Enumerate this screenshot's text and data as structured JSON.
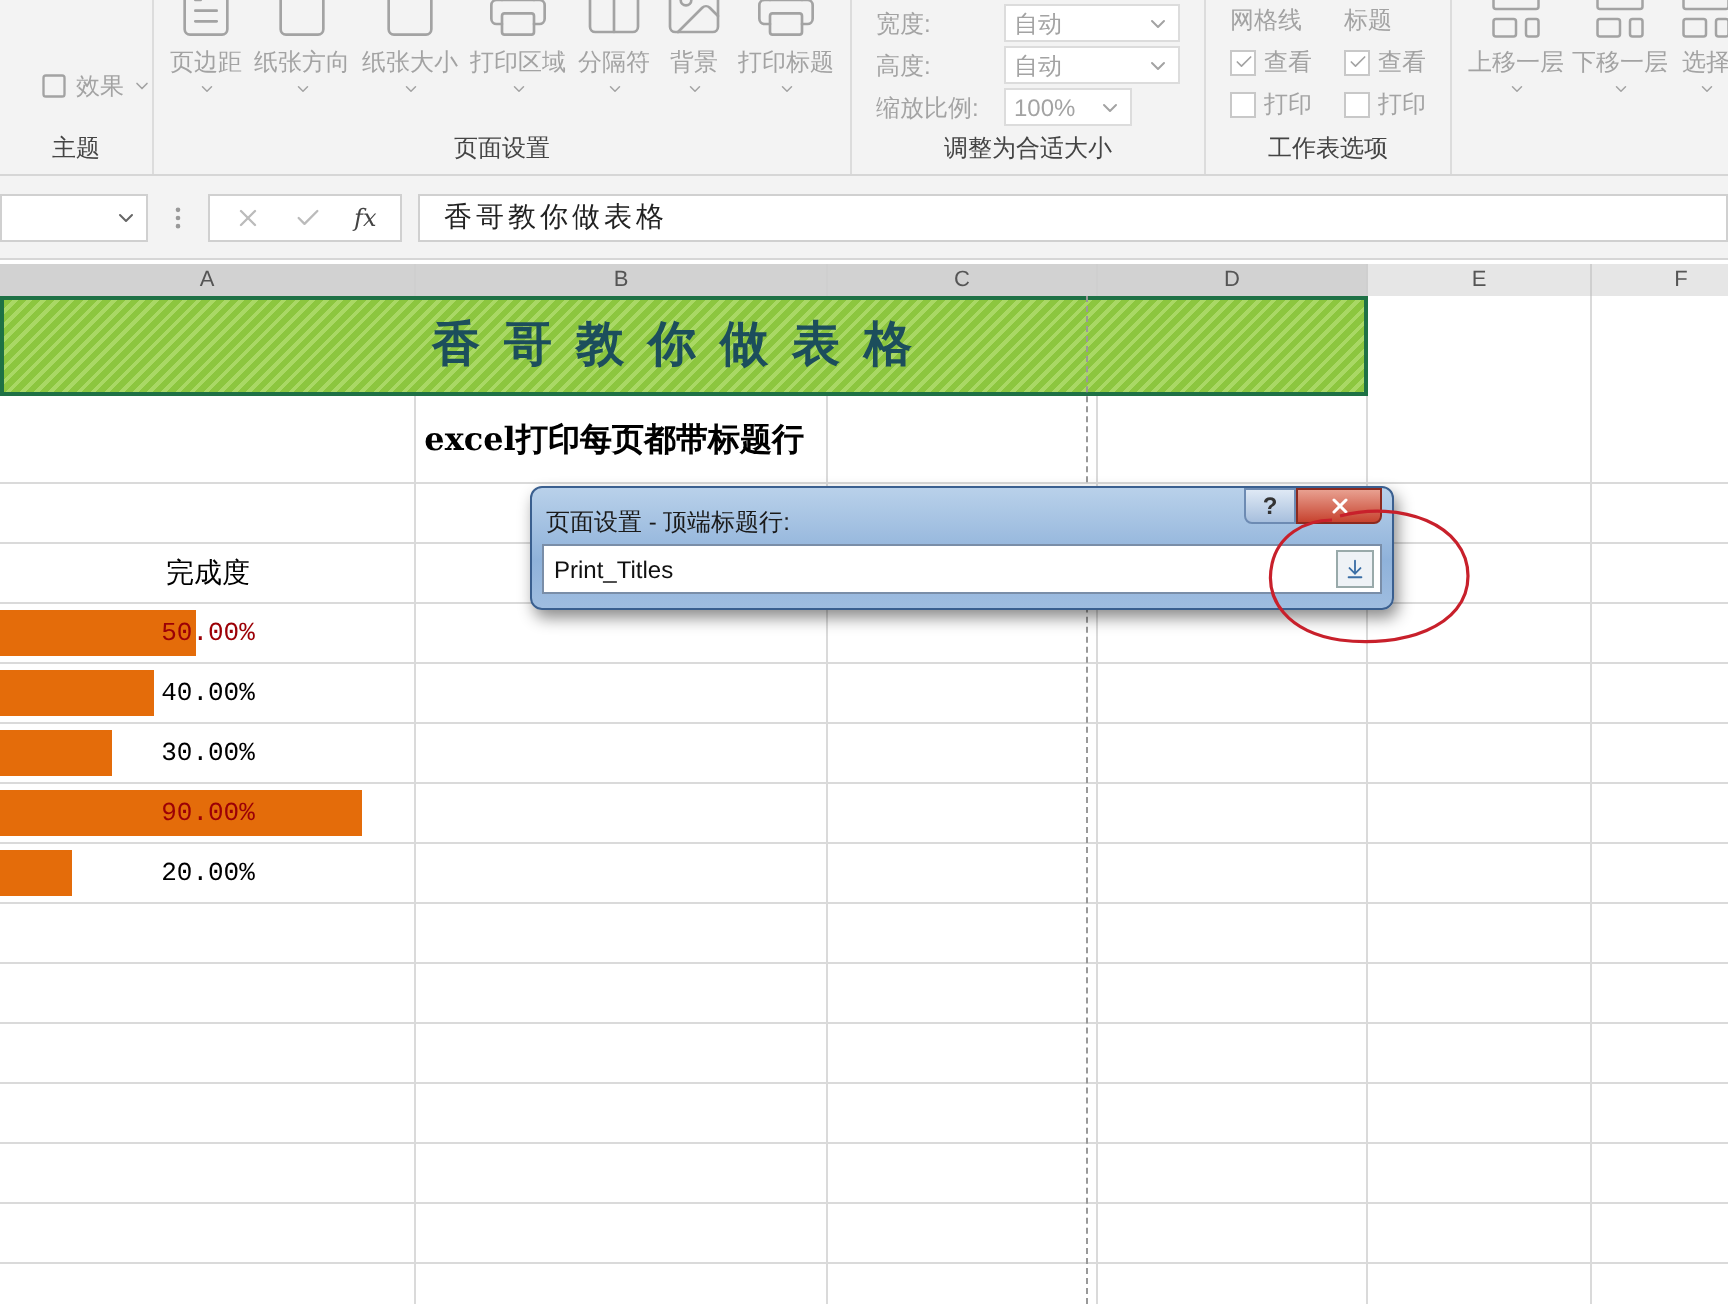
{
  "ribbon": {
    "groups": [
      {
        "kind": "theme",
        "label": "主题",
        "items": [
          {
            "label": "效果"
          }
        ]
      },
      {
        "kind": "buttons",
        "label": "页面设置",
        "buttons": [
          {
            "label": "页边距"
          },
          {
            "label": "纸张方向"
          },
          {
            "label": "纸张大小"
          },
          {
            "label": "打印区域"
          },
          {
            "label": "分隔符"
          },
          {
            "label": "背景"
          },
          {
            "label": "打印标题"
          }
        ]
      },
      {
        "kind": "scale",
        "label": "调整为合适大小",
        "fields": [
          {
            "label": "宽度:",
            "value": "自动",
            "kind": "dropdown"
          },
          {
            "label": "高度:",
            "value": "自动",
            "kind": "dropdown"
          },
          {
            "label": "缩放比例:",
            "value": "100%",
            "kind": "spinner"
          }
        ]
      },
      {
        "kind": "sheet_options",
        "label": "工作表选项",
        "columns": [
          {
            "heading": "网格线",
            "options": [
              {
                "label": "查看",
                "checked": true
              },
              {
                "label": "打印",
                "checked": false
              }
            ]
          },
          {
            "heading": "标题",
            "options": [
              {
                "label": "查看",
                "checked": true
              },
              {
                "label": "打印",
                "checked": false
              }
            ]
          }
        ]
      },
      {
        "kind": "arrange",
        "buttons": [
          {
            "label": "上移一层"
          },
          {
            "label": "下移一层"
          },
          {
            "label": "选择"
          }
        ]
      }
    ]
  },
  "formula_bar": {
    "fx_label": "fx",
    "formula": "香哥教你做表格"
  },
  "sheet": {
    "columns": [
      "A",
      "B",
      "C",
      "D",
      "E",
      "F"
    ],
    "title": "香哥教你做表格",
    "subtitle": "excel打印每页都带标题行",
    "header": "完成度",
    "rows": [
      {
        "value": "50.00%",
        "level": 0.5,
        "highlighted": true
      },
      {
        "value": "40.00%",
        "level": 0.4,
        "highlighted": false
      },
      {
        "value": "30.00%",
        "level": 0.3,
        "highlighted": false
      },
      {
        "value": "90.00%",
        "level": 0.9,
        "highlighted": true
      },
      {
        "value": "20.00%",
        "level": 0.2,
        "highlighted": false
      }
    ]
  },
  "dialog": {
    "title": "页面设置 - 顶端标题行:",
    "help_label": "?",
    "value": "Print_Titles"
  }
}
